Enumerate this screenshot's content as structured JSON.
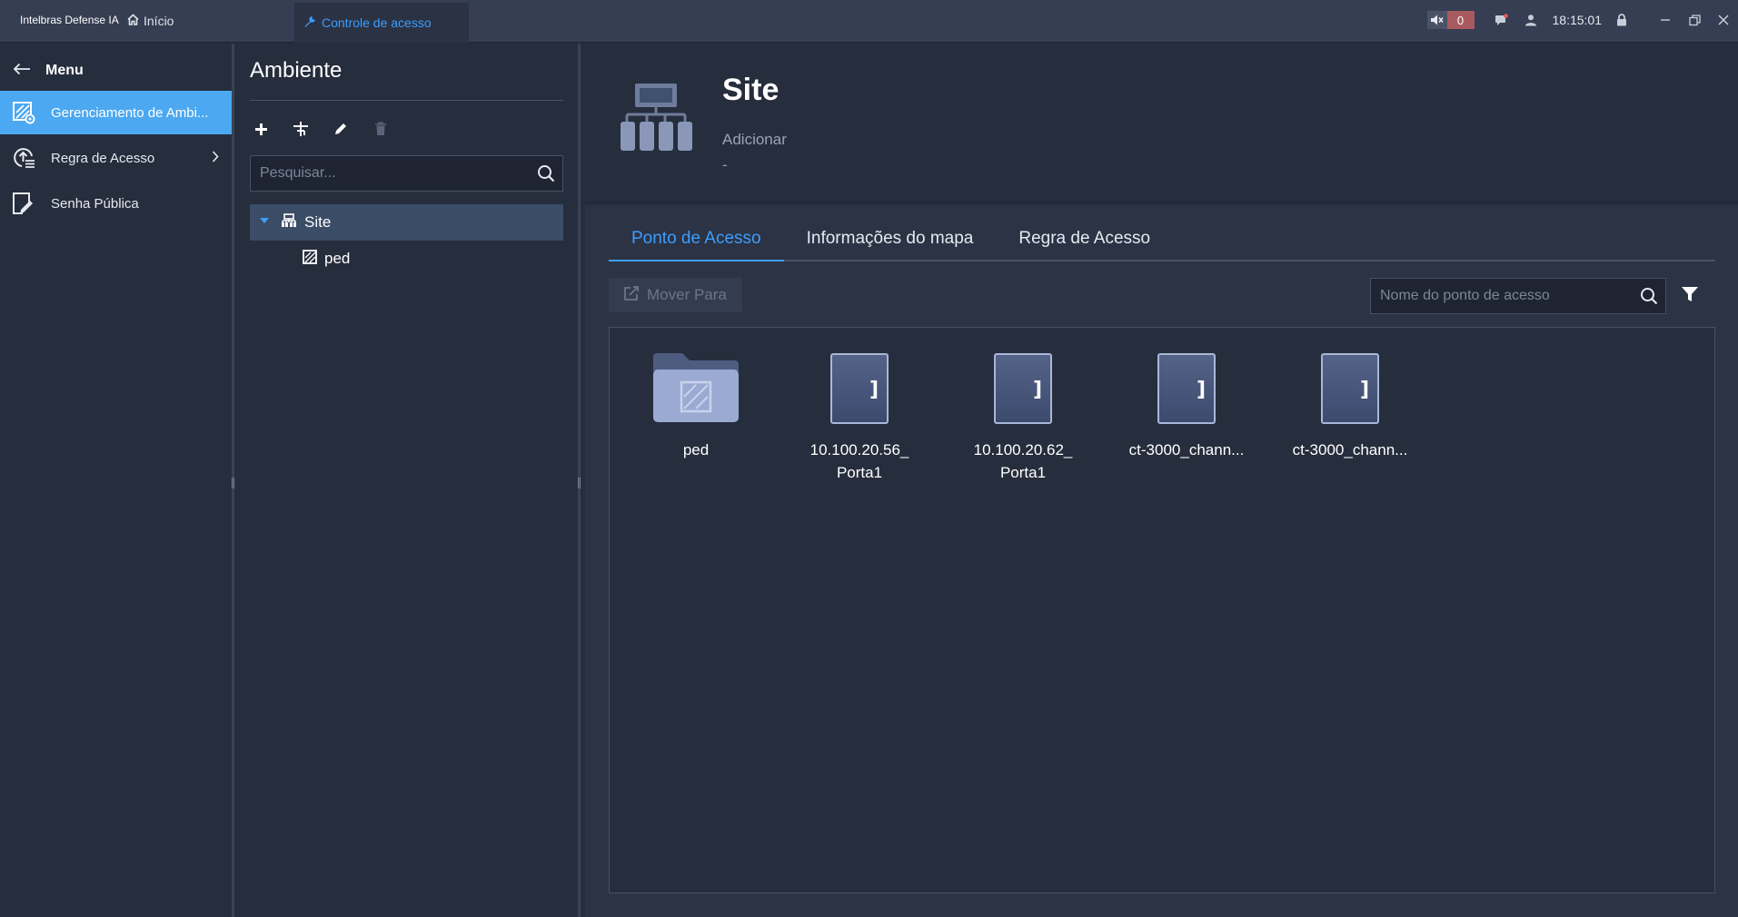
{
  "titlebar": {
    "app_name": "Intelbras Defense IA",
    "home_tab": "Início",
    "active_tab": "Controle de acesso",
    "alarm_count": "0",
    "time": "18:15:01"
  },
  "menu": {
    "title": "Menu",
    "items": [
      {
        "label": "Gerenciamento de Ambi...",
        "icon": "environment-management-icon",
        "active": true
      },
      {
        "label": "Regra de Acesso",
        "icon": "access-rule-icon",
        "active": false
      },
      {
        "label": "Senha Pública",
        "icon": "public-password-icon",
        "active": false
      }
    ]
  },
  "tree": {
    "title": "Ambiente",
    "search_placeholder": "Pesquisar...",
    "nodes": [
      {
        "label": "Site",
        "icon": "site-icon",
        "selected": true
      },
      {
        "label": "ped",
        "icon": "area-icon",
        "selected": false
      }
    ]
  },
  "site": {
    "title": "Site",
    "subtitle": "Adicionar",
    "description": "-"
  },
  "tabs": [
    "Ponto de Acesso",
    "Informações do mapa",
    "Regra de Acesso"
  ],
  "toolbar": {
    "move_label": "Mover Para",
    "search_placeholder": "Nome do ponto de acesso"
  },
  "access_points": [
    {
      "label": "ped",
      "type": "folder"
    },
    {
      "label": "10.100.20.56_ Porta1",
      "type": "door"
    },
    {
      "label": "10.100.20.62_ Porta1",
      "type": "door"
    },
    {
      "label": "ct-3000_chann...",
      "type": "door"
    },
    {
      "label": "ct-3000_chann...",
      "type": "door"
    }
  ],
  "colors": {
    "accent": "#3e9dfb",
    "active_menu": "#4ca8f0",
    "alarm_badge": "#a85a5e",
    "background": "#262d3c"
  }
}
